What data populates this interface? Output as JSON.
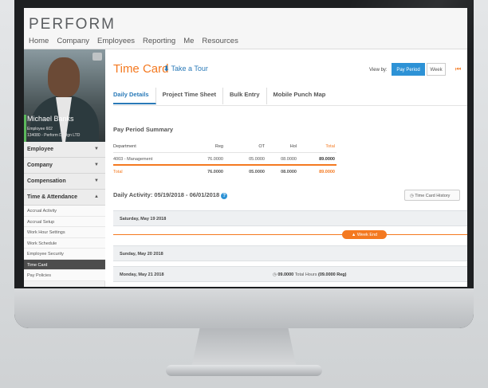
{
  "app": {
    "logo": "PERFORM",
    "nav": [
      "Home",
      "Company",
      "Employees",
      "Reporting",
      "Me",
      "Resources"
    ]
  },
  "profile": {
    "name": "Michael Banks",
    "role": "Employee 602",
    "company": "134080 - Perform Design LTD"
  },
  "sidebar": {
    "sections": [
      {
        "label": "Employee",
        "caret": "▼"
      },
      {
        "label": "Company",
        "caret": "▼"
      },
      {
        "label": "Compensation",
        "caret": "▼"
      },
      {
        "label": "Time & Attendance",
        "caret": "▲"
      }
    ],
    "items": [
      "Accrual Activity",
      "Accrual Setup",
      "Work Hour Settings",
      "Work Schedule",
      "Employee Security",
      "Time Card",
      "Pay Policies"
    ],
    "active_item": "Time Card"
  },
  "page": {
    "title": "Time Card",
    "tour_label": "Take a Tour",
    "view_by_label": "View by:",
    "view_pay_period": "Pay Period",
    "view_week": "Week"
  },
  "tabs": [
    "Daily Details",
    "Project Time Sheet",
    "Bulk Entry",
    "Mobile Punch Map"
  ],
  "summary": {
    "heading": "Pay Period Summary",
    "columns": [
      "Department",
      "Reg",
      "OT",
      "Hol",
      "Total"
    ],
    "rows": [
      [
        "4003 - Management",
        "76.0000",
        "05.0000",
        "08.0000",
        "89.0000"
      ]
    ],
    "total": [
      "Total",
      "76.0000",
      "05.0000",
      "08.0000",
      "89.0000"
    ]
  },
  "daily": {
    "heading": "Daily Activity: 05/19/2018 - 06/01/2018",
    "history_label": "Time Card History",
    "days": [
      "Saturday, May 19 2018",
      "Sunday, May 20 2018",
      "Monday, May 21 2018"
    ],
    "week_end_label": "Week End",
    "monday_hours": "09.0000",
    "monday_hours_suffix": "Total Hours",
    "monday_reg": "(09.0000 Reg)"
  },
  "colors": {
    "accent": "#f47920",
    "link": "#2a7ab8",
    "button": "#2d92d6"
  }
}
